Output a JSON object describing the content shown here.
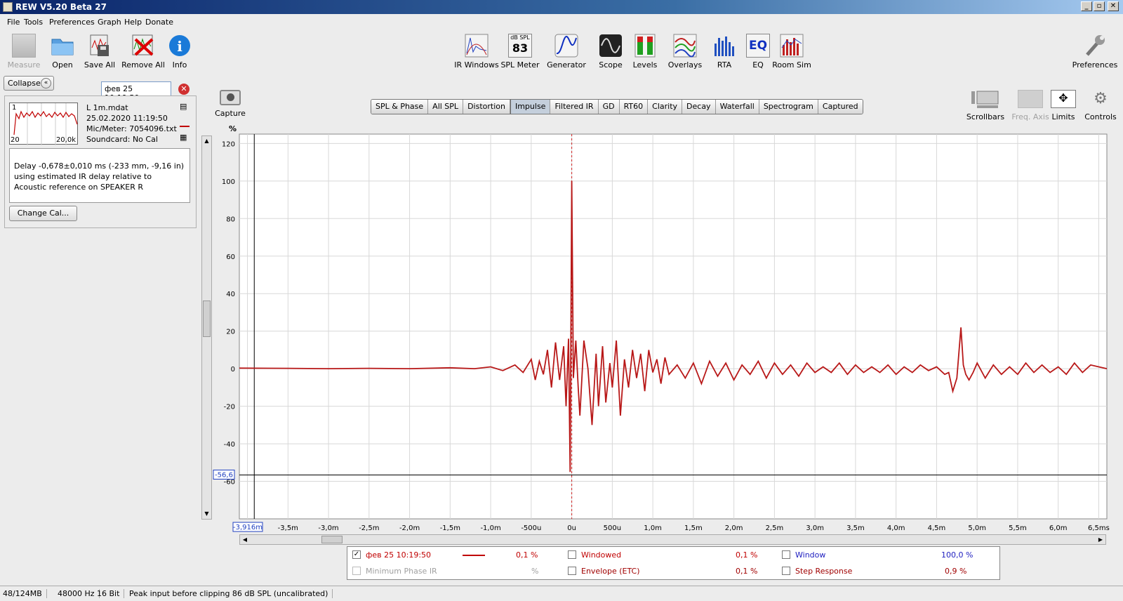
{
  "window": {
    "title": "REW V5.20 Beta 27",
    "buttons": [
      "_",
      "▫",
      "✕"
    ]
  },
  "menu": [
    "File",
    "Tools",
    "Preferences",
    "Graph",
    "Help",
    "Donate"
  ],
  "toolbar_left": [
    {
      "label": "Measure",
      "icon": "measure-icon",
      "enabled": false
    },
    {
      "label": "Open",
      "icon": "folder-icon",
      "enabled": true
    },
    {
      "label": "Save All",
      "icon": "save-icon",
      "enabled": true
    },
    {
      "label": "Remove All",
      "icon": "remove-icon",
      "enabled": true
    },
    {
      "label": "Info",
      "icon": "info-icon",
      "enabled": true
    }
  ],
  "toolbar_center": [
    {
      "label": "IR Windows",
      "icon": "ir-windows-icon"
    },
    {
      "label": "SPL Meter",
      "icon": "spl-meter-icon",
      "icon_text": "dB SPL",
      "icon_value": "83"
    },
    {
      "label": "Generator",
      "icon": "generator-icon"
    },
    {
      "label": "Scope",
      "icon": "scope-icon"
    },
    {
      "label": "Levels",
      "icon": "levels-icon"
    },
    {
      "label": "Overlays",
      "icon": "overlays-icon"
    },
    {
      "label": "RTA",
      "icon": "rta-icon"
    },
    {
      "label": "EQ",
      "icon": "eq-icon",
      "icon_text": "EQ"
    },
    {
      "label": "Room Sim",
      "icon": "room-sim-icon"
    }
  ],
  "toolbar_right": {
    "preferences": "Preferences"
  },
  "graph_tools": [
    {
      "label": "Scrollbars",
      "enabled": true
    },
    {
      "label": "Freq. Axis",
      "enabled": false
    },
    {
      "label": "Limits",
      "enabled": true
    },
    {
      "label": "Controls",
      "enabled": true
    }
  ],
  "capture_label": "Capture",
  "collapse_label": "Collapse",
  "measurement": {
    "name_field": "фев 25 10:19:50",
    "index": "1",
    "thumb_x_start": "20",
    "thumb_x_end": "20,0k",
    "file": "L 1m.mdat",
    "date": "25.02.2020 11:19:50",
    "mic": "Mic/Meter: 7054096.txt",
    "soundcard": "Soundcard: No Cal",
    "note": "Delay -0,678±0,010 ms (-233 mm, -9,16 in) using estimated IR delay relative to Acoustic reference on SPEAKER R",
    "change_cal": "Change Cal..."
  },
  "tabs": [
    {
      "label": "SPL & Phase",
      "active": false
    },
    {
      "label": "All SPL",
      "active": false
    },
    {
      "label": "Distortion",
      "active": false
    },
    {
      "label": "Impulse",
      "active": true
    },
    {
      "label": "Filtered IR",
      "active": false
    },
    {
      "label": "GD",
      "active": false
    },
    {
      "label": "RT60",
      "active": false
    },
    {
      "label": "Clarity",
      "active": false
    },
    {
      "label": "Decay",
      "active": false
    },
    {
      "label": "Waterfall",
      "active": false
    },
    {
      "label": "Spectrogram",
      "active": false
    },
    {
      "label": "Captured",
      "active": false
    }
  ],
  "cursor": {
    "y_readout": "-56,6",
    "x_readout": "-3,916m"
  },
  "chart_data": {
    "type": "line",
    "ylabel": "%",
    "ylim": [
      -80,
      125
    ],
    "xlim": [
      -4.1,
      6.6
    ],
    "y_ticks": [
      120,
      100,
      80,
      60,
      40,
      20,
      0,
      -20,
      -40,
      -60
    ],
    "y_tick_labels": [
      "120",
      "100",
      "80",
      "60",
      "40",
      "20",
      "0",
      "-20",
      "-40",
      "-60"
    ],
    "x_ticks": [
      -4.0,
      -3.5,
      -3.0,
      -2.5,
      -2.0,
      -1.5,
      -1.0,
      -0.5,
      0,
      0.5,
      1.0,
      1.5,
      2.0,
      2.5,
      3.0,
      3.5,
      4.0,
      4.5,
      5.0,
      5.5,
      6.0,
      6.5
    ],
    "x_tick_labels": [
      "-4",
      "-3,5m",
      "-3,0m",
      "-2,5m",
      "-2,0m",
      "-1,5m",
      "-1,0m",
      "-500u",
      "0u",
      "500u",
      "1,0m",
      "1,5m",
      "2,0m",
      "2,5m",
      "3,0m",
      "3,5m",
      "4,0m",
      "4,5m",
      "5,0m",
      "5,5m",
      "6,0m",
      "6,5ms"
    ],
    "grid": true,
    "marker_x": 0,
    "marker_color": "#d02020",
    "series_color": "#b81818",
    "series": [
      {
        "name": "фев 25 10:19:50",
        "x": [
          -4.1,
          -3.5,
          -3.0,
          -2.5,
          -2.0,
          -1.5,
          -1.2,
          -1.0,
          -0.85,
          -0.7,
          -0.6,
          -0.5,
          -0.45,
          -0.4,
          -0.35,
          -0.3,
          -0.25,
          -0.2,
          -0.15,
          -0.1,
          -0.07,
          -0.04,
          -0.02,
          0,
          0.02,
          0.05,
          0.08,
          0.1,
          0.15,
          0.2,
          0.25,
          0.3,
          0.33,
          0.38,
          0.42,
          0.47,
          0.5,
          0.55,
          0.6,
          0.65,
          0.7,
          0.75,
          0.8,
          0.85,
          0.9,
          0.95,
          1.0,
          1.05,
          1.1,
          1.15,
          1.2,
          1.3,
          1.4,
          1.5,
          1.6,
          1.7,
          1.8,
          1.9,
          2.0,
          2.1,
          2.2,
          2.3,
          2.4,
          2.5,
          2.6,
          2.7,
          2.8,
          2.9,
          3.0,
          3.1,
          3.2,
          3.3,
          3.4,
          3.5,
          3.6,
          3.7,
          3.8,
          3.9,
          4.0,
          4.1,
          4.2,
          4.3,
          4.4,
          4.5,
          4.6,
          4.65,
          4.7,
          4.75,
          4.8,
          4.83,
          4.86,
          4.9,
          4.95,
          5.0,
          5.1,
          5.2,
          5.3,
          5.4,
          5.5,
          5.6,
          5.7,
          5.8,
          5.9,
          6.0,
          6.1,
          6.2,
          6.3,
          6.4,
          6.5,
          6.6
        ],
        "values": [
          0.3,
          0.2,
          0,
          0.2,
          0,
          0.5,
          0,
          1,
          -1,
          2,
          -2,
          5,
          -6,
          4,
          -3,
          10,
          -10,
          14,
          -6,
          12,
          -20,
          16,
          -55,
          100,
          -5,
          15,
          -10,
          -25,
          15,
          0,
          -30,
          8,
          -20,
          12,
          -18,
          3,
          -10,
          15,
          -25,
          5,
          -10,
          10,
          -5,
          8,
          -12,
          10,
          -2,
          5,
          -8,
          6,
          -3,
          2,
          -5,
          3,
          -8,
          4,
          -4,
          3,
          -6,
          2,
          -3,
          4,
          -5,
          3,
          -3,
          2,
          -4,
          3,
          -2,
          1,
          -2,
          3,
          -3,
          2,
          -2,
          1,
          -2,
          2,
          -3,
          1,
          -2,
          2,
          -1,
          1,
          -3,
          -2,
          -12,
          -5,
          22,
          2,
          -3,
          -6,
          -2,
          3,
          -5,
          2,
          -3,
          1,
          -3,
          3,
          -2,
          2,
          -2,
          1,
          -3,
          3,
          -2,
          2,
          1,
          0
        ]
      }
    ]
  },
  "legend": {
    "rows": [
      [
        {
          "label": "фев 25 10:19:50",
          "value": "0,1 %",
          "checked": true,
          "color": "#c00000",
          "enabled": true
        },
        {
          "label": "Windowed",
          "value": "0,1 %",
          "checked": false,
          "color": "#c00000",
          "enabled": true
        },
        {
          "label": "Window",
          "value": "100,0 %",
          "checked": false,
          "color": "#2020c0",
          "enabled": true
        }
      ],
      [
        {
          "label": "Minimum Phase IR",
          "value": "%",
          "checked": false,
          "color": "#a0a0a0",
          "enabled": false
        },
        {
          "label": "Envelope (ETC)",
          "value": "0,1 %",
          "checked": false,
          "color": "#a00000",
          "enabled": true
        },
        {
          "label": "Step Response",
          "value": "0,9 %",
          "checked": false,
          "color": "#a00000",
          "enabled": true
        }
      ]
    ]
  },
  "status": [
    "48/124MB",
    "48000 Hz",
    "16 Bit",
    "Peak input before clipping 86 dB SPL (uncalibrated)"
  ]
}
